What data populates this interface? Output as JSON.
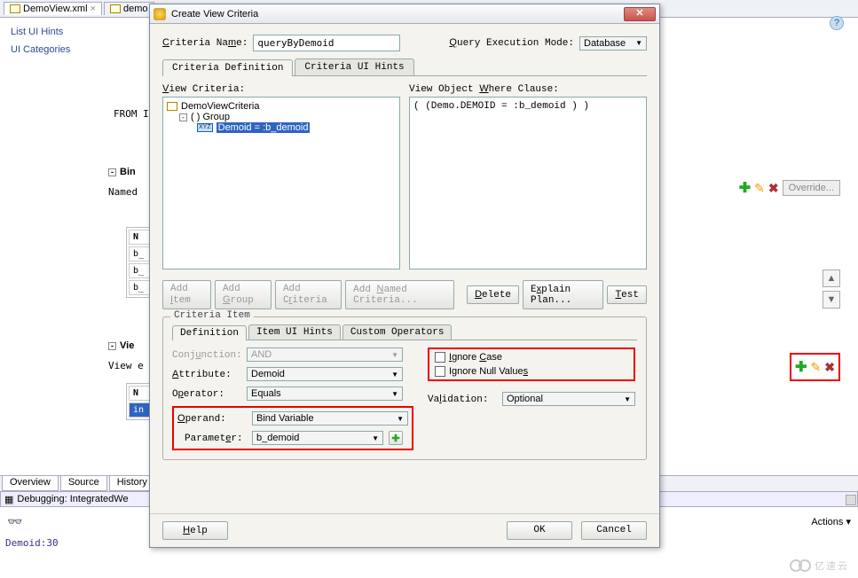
{
  "editor": {
    "tabs": [
      {
        "label": "DemoView.xml",
        "close": "×"
      },
      {
        "label": "demo"
      }
    ],
    "help_icon": "?",
    "left_items": [
      "List UI Hints",
      "UI Categories"
    ],
    "from_text": "FROM I",
    "sections": {
      "bin": {
        "toggle": "-",
        "label": "Bin"
      },
      "named": "Named",
      "vie": {
        "toggle": "-",
        "label": "Vie"
      },
      "view_e": "View e"
    },
    "grid": {
      "head": "N",
      "rows": [
        "b_",
        "b_",
        "b_"
      ]
    },
    "view_grid": {
      "head": "N",
      "sel_row": "in"
    },
    "override_btn": "Override...",
    "bottom_tabs": [
      "Overview",
      "Source",
      "History"
    ],
    "debug_label": "Debugging: IntegratedWe",
    "actions_label": "Actions ▾",
    "status": "Demoid:30",
    "watermark": "亿速云",
    "arrows": {
      "up": "▲",
      "down": "▼"
    }
  },
  "dialog": {
    "title": "Create View Criteria",
    "close": "✕",
    "criteria_name_label": "Criteria Name:",
    "criteria_name_value": "queryByDemoid",
    "exec_mode_label": "Query Execution Mode:",
    "exec_mode_value": "Database",
    "tabs": {
      "def": "Criteria Definition",
      "ui": "Criteria UI Hints"
    },
    "view_criteria_label": "View Criteria:",
    "where_label": "View Object Where Clause:",
    "tree": {
      "root": "DemoViewCriteria",
      "group": "( ) Group",
      "leaf": "Demoid = :b_demoid",
      "xyz": "XYZ"
    },
    "where_text": "( (Demo.DEMOID = :b_demoid ) )",
    "buttons": {
      "add_item": "Add Item",
      "add_group": "Add Group",
      "add_criteria": "Add Criteria",
      "add_named": "Add Named Criteria...",
      "delete": "Delete",
      "explain": "Explain Plan...",
      "test": "Test"
    },
    "criteria_item_legend": "Criteria Item",
    "item_tabs": {
      "def": "Definition",
      "ui": "Item UI Hints",
      "cust": "Custom Operators"
    },
    "form": {
      "conjunction_label": "Conjunction:",
      "conjunction_value": "AND",
      "attribute_label": "Attribute:",
      "attribute_value": "Demoid",
      "operator_label": "Operator:",
      "operator_value": "Equals",
      "operand_label": "Operand:",
      "operand_value": "Bind Variable",
      "parameter_label": "Parameter:",
      "parameter_value": "b_demoid",
      "ignore_case": "Ignore Case",
      "ignore_null": "Ignore Null Values",
      "validation_label": "Validation:",
      "validation_value": "Optional"
    },
    "footer": {
      "help": "Help",
      "ok": "OK",
      "cancel": "Cancel"
    },
    "plus": "✚",
    "tri": "▼"
  }
}
